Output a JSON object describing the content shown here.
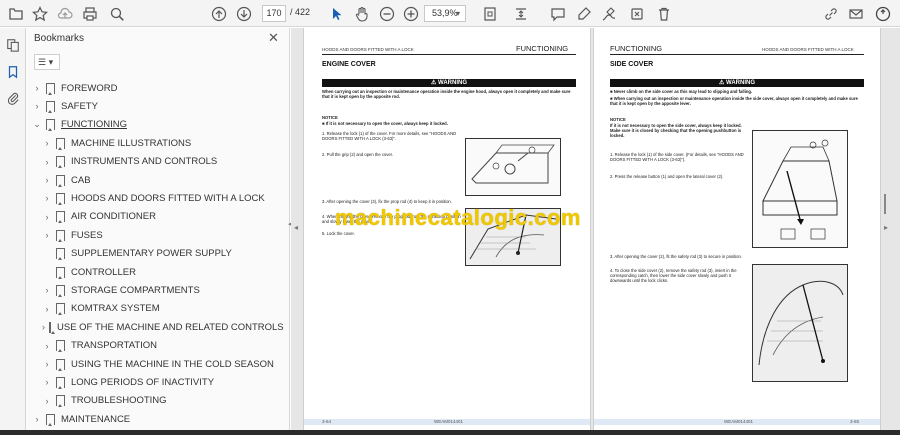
{
  "toolbar": {
    "current_page": "170",
    "total_pages": "/ 422",
    "zoom": "53,9%"
  },
  "bookmarks": {
    "title": "Bookmarks",
    "items": [
      {
        "label": "FOREWORD",
        "level": 0,
        "chevron": "›",
        "active": false
      },
      {
        "label": "SAFETY",
        "level": 0,
        "chevron": "›",
        "active": false
      },
      {
        "label": "FUNCTIONING",
        "level": 0,
        "chevron": "⌄",
        "active": true
      },
      {
        "label": "MACHINE ILLUSTRATIONS",
        "level": 1,
        "chevron": "›",
        "active": false
      },
      {
        "label": "INSTRUMENTS AND CONTROLS",
        "level": 1,
        "chevron": "›",
        "active": false
      },
      {
        "label": "CAB",
        "level": 1,
        "chevron": "›",
        "active": false
      },
      {
        "label": "HOODS AND DOORS FITTED WITH A LOCK",
        "level": 1,
        "chevron": "›",
        "active": false
      },
      {
        "label": "AIR CONDITIONER",
        "level": 1,
        "chevron": "›",
        "active": false
      },
      {
        "label": "FUSES",
        "level": 1,
        "chevron": "›",
        "active": false
      },
      {
        "label": "SUPPLEMENTARY POWER SUPPLY",
        "level": 1,
        "chevron": "",
        "active": false
      },
      {
        "label": "CONTROLLER",
        "level": 1,
        "chevron": "",
        "active": false
      },
      {
        "label": "STORAGE COMPARTMENTS",
        "level": 1,
        "chevron": "›",
        "active": false
      },
      {
        "label": "KOMTRAX SYSTEM",
        "level": 1,
        "chevron": "›",
        "active": false
      },
      {
        "label": "USE OF THE MACHINE AND RELATED CONTROLS",
        "level": 1,
        "chevron": "›",
        "active": false
      },
      {
        "label": "TRANSPORTATION",
        "level": 1,
        "chevron": "›",
        "active": false
      },
      {
        "label": "USING THE MACHINE IN THE COLD SEASON",
        "level": 1,
        "chevron": "›",
        "active": false
      },
      {
        "label": "LONG PERIODS OF INACTIVITY",
        "level": 1,
        "chevron": "›",
        "active": false
      },
      {
        "label": "TROUBLESHOOTING",
        "level": 1,
        "chevron": "›",
        "active": false
      },
      {
        "label": "MAINTENANCE",
        "level": 0,
        "chevron": "›",
        "active": false
      }
    ]
  },
  "left_page": {
    "header_small": "HOODS AND DOORS FITTED WITH A LOCK",
    "header_big": "FUNCTIONING",
    "section": "ENGINE COVER",
    "warning": "⚠ WARNING",
    "warning_text": "When carrying out an inspection or maintenance operation inside the engine hood, always open it completely and make sure that it is kept open by the apposite rod.",
    "notice_title": "NOTICE",
    "notice_text": "■ If it is not necessary to open the cover, always keep it locked.",
    "step1": "1. Release the lock (1) of the cover. For more details, see \"HOODS AND DOORS FITTED WITH A LOCK (3-63)\".",
    "step2": "2. Pull the grip (2) and open the cover.",
    "step3": "3. After opening the cover (3), fix the prop rod (4) to keep it in position.",
    "step4": "4. When closing the cover, remove the prop rod from the retraction position and slowly lower the cover.",
    "step5": "5. Lock the cover.",
    "foot_left": "3-64",
    "foot_mid": "WEAM014401"
  },
  "right_page": {
    "header_big": "FUNCTIONING",
    "header_small": "HOODS AND DOORS FITTED WITH A LOCK",
    "section": "SIDE COVER",
    "warning": "⚠ WARNING",
    "warning_text1": "■ Never climb on the side cover as this may lead to slipping and falling.",
    "warning_text2": "■ When carrying out an inspection or maintenance operation inside the side cover, always open it completely and make sure that it is kept open by the apposite lever.",
    "notice_title": "NOTICE",
    "notice_text": "If it is not necessary to open the side cover, always keep it locked. Make sure it is closed by checking that the opening pushbutton is locked.",
    "step1": "1. Release the lock (1) of the side cover. (For details, see \"HOODS AND DOORS FITTED WITH A LOCK (3-63)\").",
    "step2": "2. Press the release button (1) and open the lateral cover (2).",
    "step3": "3. After opening the cover (2), fit the safety rod (3) to secure in position.",
    "step4": "4. To close the side cover (2), remove the safety rod (3), insert in the corresponding catch, then lower the side cover slowly and push it downwards until the lock clicks.",
    "foot_mid": "WEAM014401",
    "foot_right": "3-65"
  },
  "watermark": "machinecatalogic.com"
}
